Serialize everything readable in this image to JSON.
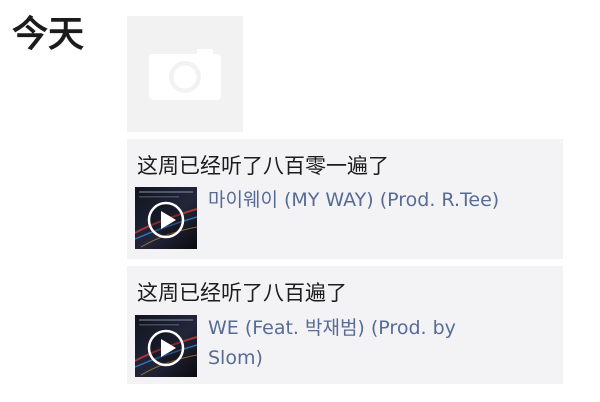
{
  "feed": {
    "date_label": "今天",
    "photo_icon": "camera-icon",
    "posts": [
      {
        "text": "这周已经听了八百零一遍了",
        "song": {
          "title": "마이웨이 (MY WAY) (Prod. R.Tee)"
        },
        "icons": [
          "album-art",
          "play-icon"
        ]
      },
      {
        "text": "这周已经听了八百遍了",
        "song": {
          "title": "WE (Feat. 박재범) (Prod. by Slom)"
        },
        "icons": [
          "album-art",
          "play-icon"
        ]
      }
    ]
  },
  "colors": {
    "link": "#576b95",
    "card_bg": "#f3f3f5",
    "thumb_bg": "#f2f2f2"
  }
}
